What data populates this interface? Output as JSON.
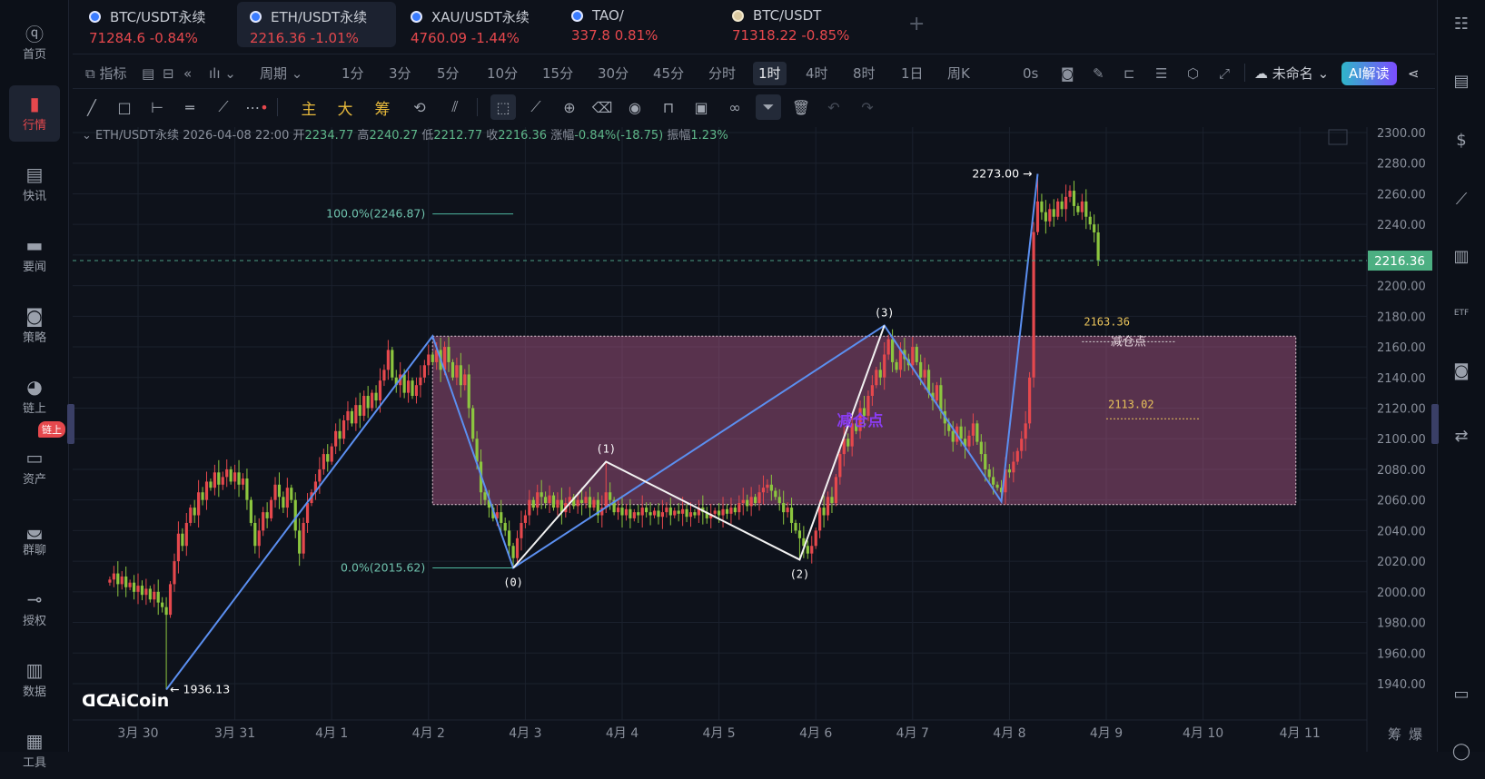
{
  "left_sidebar": {
    "items": [
      {
        "label": "首页",
        "icon": "aicoin-logo-icon"
      },
      {
        "label": "行情",
        "icon": "bar-chart-icon",
        "active": true
      },
      {
        "label": "快讯",
        "icon": "flash-news-icon"
      },
      {
        "label": "要闻",
        "icon": "document-icon"
      },
      {
        "label": "策略",
        "icon": "robot-icon"
      },
      {
        "label": "链上",
        "icon": "chain-icon"
      },
      {
        "label": "资产",
        "icon": "wallet-icon"
      },
      {
        "label": "群聊",
        "icon": "chat-icon"
      },
      {
        "label": "授权",
        "icon": "key-icon"
      },
      {
        "label": "数据",
        "icon": "monitor-chart-icon"
      },
      {
        "label": "工具",
        "icon": "grid-icon"
      }
    ],
    "badge": "链上"
  },
  "tabs": [
    {
      "name": "BTC/USDT永续",
      "quote": "71284.6  -0.84%"
    },
    {
      "name": "ETH/USDT永续",
      "quote": "2216.36  -1.01%",
      "active": true
    },
    {
      "name": "XAU/USDT永续",
      "quote": "4760.09  -1.44%"
    },
    {
      "name": "TAO/",
      "quote": "337.8  0.81%"
    },
    {
      "name": "BTC/USDT",
      "quote": "71318.22  -0.85%"
    }
  ],
  "toolbar": {
    "indicator": "指标",
    "period": "周期",
    "intervals": [
      "1分",
      "3分",
      "5分",
      "10分",
      "15分",
      "30分",
      "45分",
      "分时",
      "1时",
      "4时",
      "8时",
      "1日",
      "周K"
    ],
    "active_interval": "1时",
    "countdown": "0s",
    "layout_name": "未命名",
    "ai": "AI解读",
    "main": "主",
    "big": "大",
    "chips": "筹"
  },
  "info": {
    "symbol": "ETH/USDT永续",
    "time": "2026-04-08 22:00",
    "open_label": "开",
    "open": "2234.77",
    "high_label": "高",
    "high": "2240.27",
    "low_label": "低",
    "low": "2212.77",
    "close_label": "收",
    "close": "2216.36",
    "change_label": "涨幅",
    "change": "-0.84%(-18.75)",
    "amp_label": "振幅",
    "amp": "1.23%"
  },
  "bottom_right": {
    "chips": "筹",
    "liq": "爆"
  },
  "watermark": "AiCoin",
  "colors": {
    "up": "#e5484d",
    "down": "#8cc63f",
    "background": "#0e121b",
    "grid": "#1b212d",
    "price_tag": "#4caf82",
    "zigzag_blue": "#5b8ff0",
    "wave_white": "#f2f2f2",
    "box_fill": "#b45a8c",
    "label_yellow": "#e8c25a",
    "purple_label": "#8a3cf0"
  },
  "chart_data": {
    "type": "candlestick",
    "interval": "1h",
    "y_ticks": [
      2300,
      2280,
      2260,
      2240,
      2220,
      2200,
      2180,
      2160,
      2140,
      2120,
      2100,
      2080,
      2060,
      2040,
      2020,
      2000,
      1980,
      1960,
      1940
    ],
    "y_tick_labels": [
      "2300.00",
      "2280.00",
      "2260.00",
      "2240.00",
      "2220.00",
      "2200.00",
      "2180.00",
      "2160.00",
      "2140.00",
      "2120.00",
      "2100.00",
      "2080.00",
      "2060.00",
      "2040.00",
      "2020.00",
      "2000.00",
      "1980.00",
      "1960.00",
      "1940.00"
    ],
    "x_ticks": [
      {
        "date": "2026-03-30",
        "label": "3月 30"
      },
      {
        "date": "2026-03-31",
        "label": "3月 31"
      },
      {
        "date": "2026-04-01",
        "label": "4月 1"
      },
      {
        "date": "2026-04-02",
        "label": "4月 2"
      },
      {
        "date": "2026-04-03",
        "label": "4月 3"
      },
      {
        "date": "2026-04-04",
        "label": "4月 4"
      },
      {
        "date": "2026-04-05",
        "label": "4月 5"
      },
      {
        "date": "2026-04-06",
        "label": "4月 6"
      },
      {
        "date": "2026-04-07",
        "label": "4月 7"
      },
      {
        "date": "2026-04-08",
        "label": "4月 8"
      },
      {
        "date": "2026-04-09",
        "label": "4月 9"
      },
      {
        "date": "2026-04-10",
        "label": "4月 10"
      },
      {
        "date": "2026-04-11",
        "label": "4月 11"
      }
    ],
    "grid": true,
    "first_candle": "2026-03-29 17:00",
    "first_open": 2006,
    "closes": [
      2008,
      2012,
      2005,
      2010,
      2003,
      2006,
      2000,
      2004,
      1998,
      2002,
      1995,
      2000,
      1993,
      1990,
      1985,
      2005,
      2020,
      2038,
      2030,
      2045,
      2055,
      2050,
      2065,
      2060,
      2072,
      2068,
      2078,
      2070,
      2075,
      2080,
      2072,
      2078,
      2070,
      2074,
      2060,
      2045,
      2030,
      2040,
      2052,
      2048,
      2060,
      2070,
      2062,
      2055,
      2068,
      2060,
      2040,
      2025,
      2045,
      2058,
      2065,
      2072,
      2080,
      2090,
      2085,
      2095,
      2105,
      2100,
      2112,
      2118,
      2110,
      2122,
      2115,
      2128,
      2120,
      2130,
      2125,
      2138,
      2145,
      2158,
      2140,
      2135,
      2142,
      2130,
      2138,
      2128,
      2135,
      2140,
      2148,
      2155,
      2150,
      2158,
      2145,
      2160,
      2150,
      2140,
      2148,
      2135,
      2142,
      2120,
      2100,
      2085,
      2065,
      2060,
      2055,
      2048,
      2052,
      2045,
      2040,
      2030,
      2022,
      2035,
      2045,
      2050,
      2060,
      2055,
      2065,
      2062,
      2058,
      2063,
      2055,
      2060,
      2052,
      2058,
      2062,
      2056,
      2060,
      2058,
      2062,
      2055,
      2060,
      2050,
      2055,
      2065,
      2060,
      2052,
      2055,
      2050,
      2054,
      2048,
      2052,
      2050,
      2055,
      2052,
      2050,
      2053,
      2049,
      2052,
      2055,
      2050,
      2053,
      2051,
      2054,
      2049,
      2052,
      2050,
      2055,
      2052,
      2048,
      2051,
      2053,
      2050,
      2054,
      2051,
      2055,
      2052,
      2058,
      2060,
      2056,
      2062,
      2058,
      2065,
      2068,
      2070,
      2066,
      2062,
      2058,
      2052,
      2055,
      2045,
      2040,
      2035,
      2030,
      2025,
      2030,
      2040,
      2055,
      2050,
      2062,
      2058,
      2075,
      2090,
      2100,
      2095,
      2110,
      2105,
      2120,
      2115,
      2128,
      2135,
      2145,
      2140,
      2155,
      2165,
      2150,
      2145,
      2158,
      2152,
      2148,
      2160,
      2150,
      2140,
      2145,
      2130,
      2125,
      2135,
      2118,
      2110,
      2105,
      2098,
      2108,
      2100,
      2095,
      2102,
      2110,
      2098,
      2090,
      2080,
      2075,
      2070,
      2068,
      2065,
      2080,
      2078,
      2085,
      2092,
      2100,
      2110,
      2140,
      2235,
      2255,
      2248,
      2242,
      2250,
      2245,
      2255,
      2250,
      2258,
      2262,
      2252,
      2248,
      2255,
      2245,
      2240,
      2234.77,
      2216.36
    ],
    "extreme_highs": [
      {
        "time": "2026-04-08 07:00",
        "price": 2273.0
      },
      {
        "time": "2026-04-02 02:00",
        "price": 2163
      },
      {
        "time": "2026-04-06 18:00",
        "price": 2168
      },
      {
        "time": "2026-04-03 20:00",
        "price": 2085
      },
      {
        "time": "2026-04-08 22:00",
        "price": 2240.27
      }
    ],
    "extreme_lows": [
      {
        "time": "2026-03-30 07:00",
        "price": 1936.13
      },
      {
        "time": "2026-04-02 21:00",
        "price": 2015.62
      },
      {
        "time": "2026-04-05 20:00",
        "price": 2021
      },
      {
        "time": "2026-04-08 22:00",
        "price": 2212.77
      }
    ],
    "last_price": {
      "price": 2216.36,
      "label": "2216.36"
    },
    "annotations": {
      "high": {
        "time": "2026-04-08 07:00",
        "price": 2273.0,
        "label": "2273.00 →"
      },
      "low": {
        "time": "2026-03-30 07:00",
        "price": 1936.13,
        "label": "← 1936.13"
      }
    },
    "zigzag": [
      {
        "time": "2026-03-30 07:00",
        "price": 1936.13
      },
      {
        "time": "2026-04-02 01:00",
        "price": 2167
      },
      {
        "time": "2026-04-02 21:00",
        "price": 2015.62
      },
      {
        "time": "2026-04-06 17:00",
        "price": 2174
      },
      {
        "time": "2026-04-07 22:00",
        "price": 2059
      },
      {
        "time": "2026-04-08 07:00",
        "price": 2273.0
      }
    ],
    "waves": [
      {
        "label": "(0)",
        "time": "2026-04-02 21:00",
        "price": 2015.62,
        "pos": "below"
      },
      {
        "label": "(1)",
        "time": "2026-04-03 20:00",
        "price": 2085,
        "pos": "above"
      },
      {
        "label": "(2)",
        "time": "2026-04-05 20:00",
        "price": 2021,
        "pos": "below"
      },
      {
        "label": "(3)",
        "time": "2026-04-06 17:00",
        "price": 2174,
        "pos": "above"
      }
    ],
    "box": {
      "start": "2026-04-02 01:00",
      "end": "2026-04-10 23:00",
      "top": 2167,
      "bottom": 2057
    },
    "fib": [
      {
        "label": "100.0%(2246.87)",
        "price": 2246.87,
        "start": "2026-04-02 01:00",
        "end": "2026-04-02 21:00"
      },
      {
        "label": "0.0%(2015.62)",
        "price": 2015.62,
        "start": "2026-04-02 01:00",
        "end": "2026-04-02 21:00"
      }
    ],
    "levels": [
      {
        "label": "2163.36",
        "price": 2163.36,
        "text": "减仓点",
        "start": "2026-04-08 18:00",
        "end": "2026-04-09 17:00"
      },
      {
        "label": "2113.02",
        "price": 2113.02,
        "start": "2026-04-09 00:00",
        "end": "2026-04-09 23:00"
      }
    ],
    "purple_label": {
      "text": "减仓点",
      "time": "2026-04-06 11:00",
      "price": 2112
    }
  }
}
